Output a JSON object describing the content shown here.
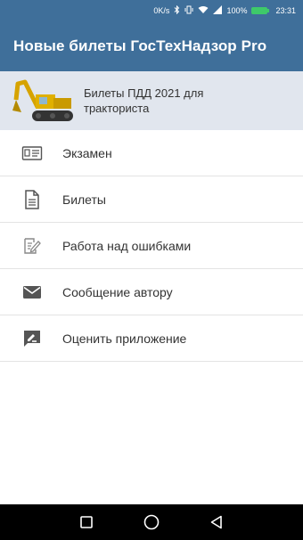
{
  "status_bar": {
    "speed": "0K/s",
    "battery_percent": "100%",
    "time": "23:31",
    "icons": [
      "bluetooth-icon",
      "vibrate-icon",
      "wifi-icon",
      "signal-icon",
      "battery-icon"
    ],
    "battery_color": "#3ec96a"
  },
  "app_bar": {
    "title": "Новые билеты ГосТехНадзор Pro",
    "color": "#3f6f9a"
  },
  "header": {
    "text": "Билеты ПДД 2021 для тракториста",
    "image": "excavator-image",
    "background": "#e1e6ee"
  },
  "menu": {
    "items": [
      {
        "label": "Экзамен",
        "icon": "id-card-icon"
      },
      {
        "label": "Билеты",
        "icon": "document-icon"
      },
      {
        "label": "Работа над ошибками",
        "icon": "edit-document-icon"
      },
      {
        "label": "Сообщение автору",
        "icon": "mail-icon"
      },
      {
        "label": "Оценить приложение",
        "icon": "rate-review-icon"
      }
    ]
  },
  "nav_bar": {
    "icons": [
      "recents-square-icon",
      "home-circle-icon",
      "back-triangle-icon"
    ]
  }
}
